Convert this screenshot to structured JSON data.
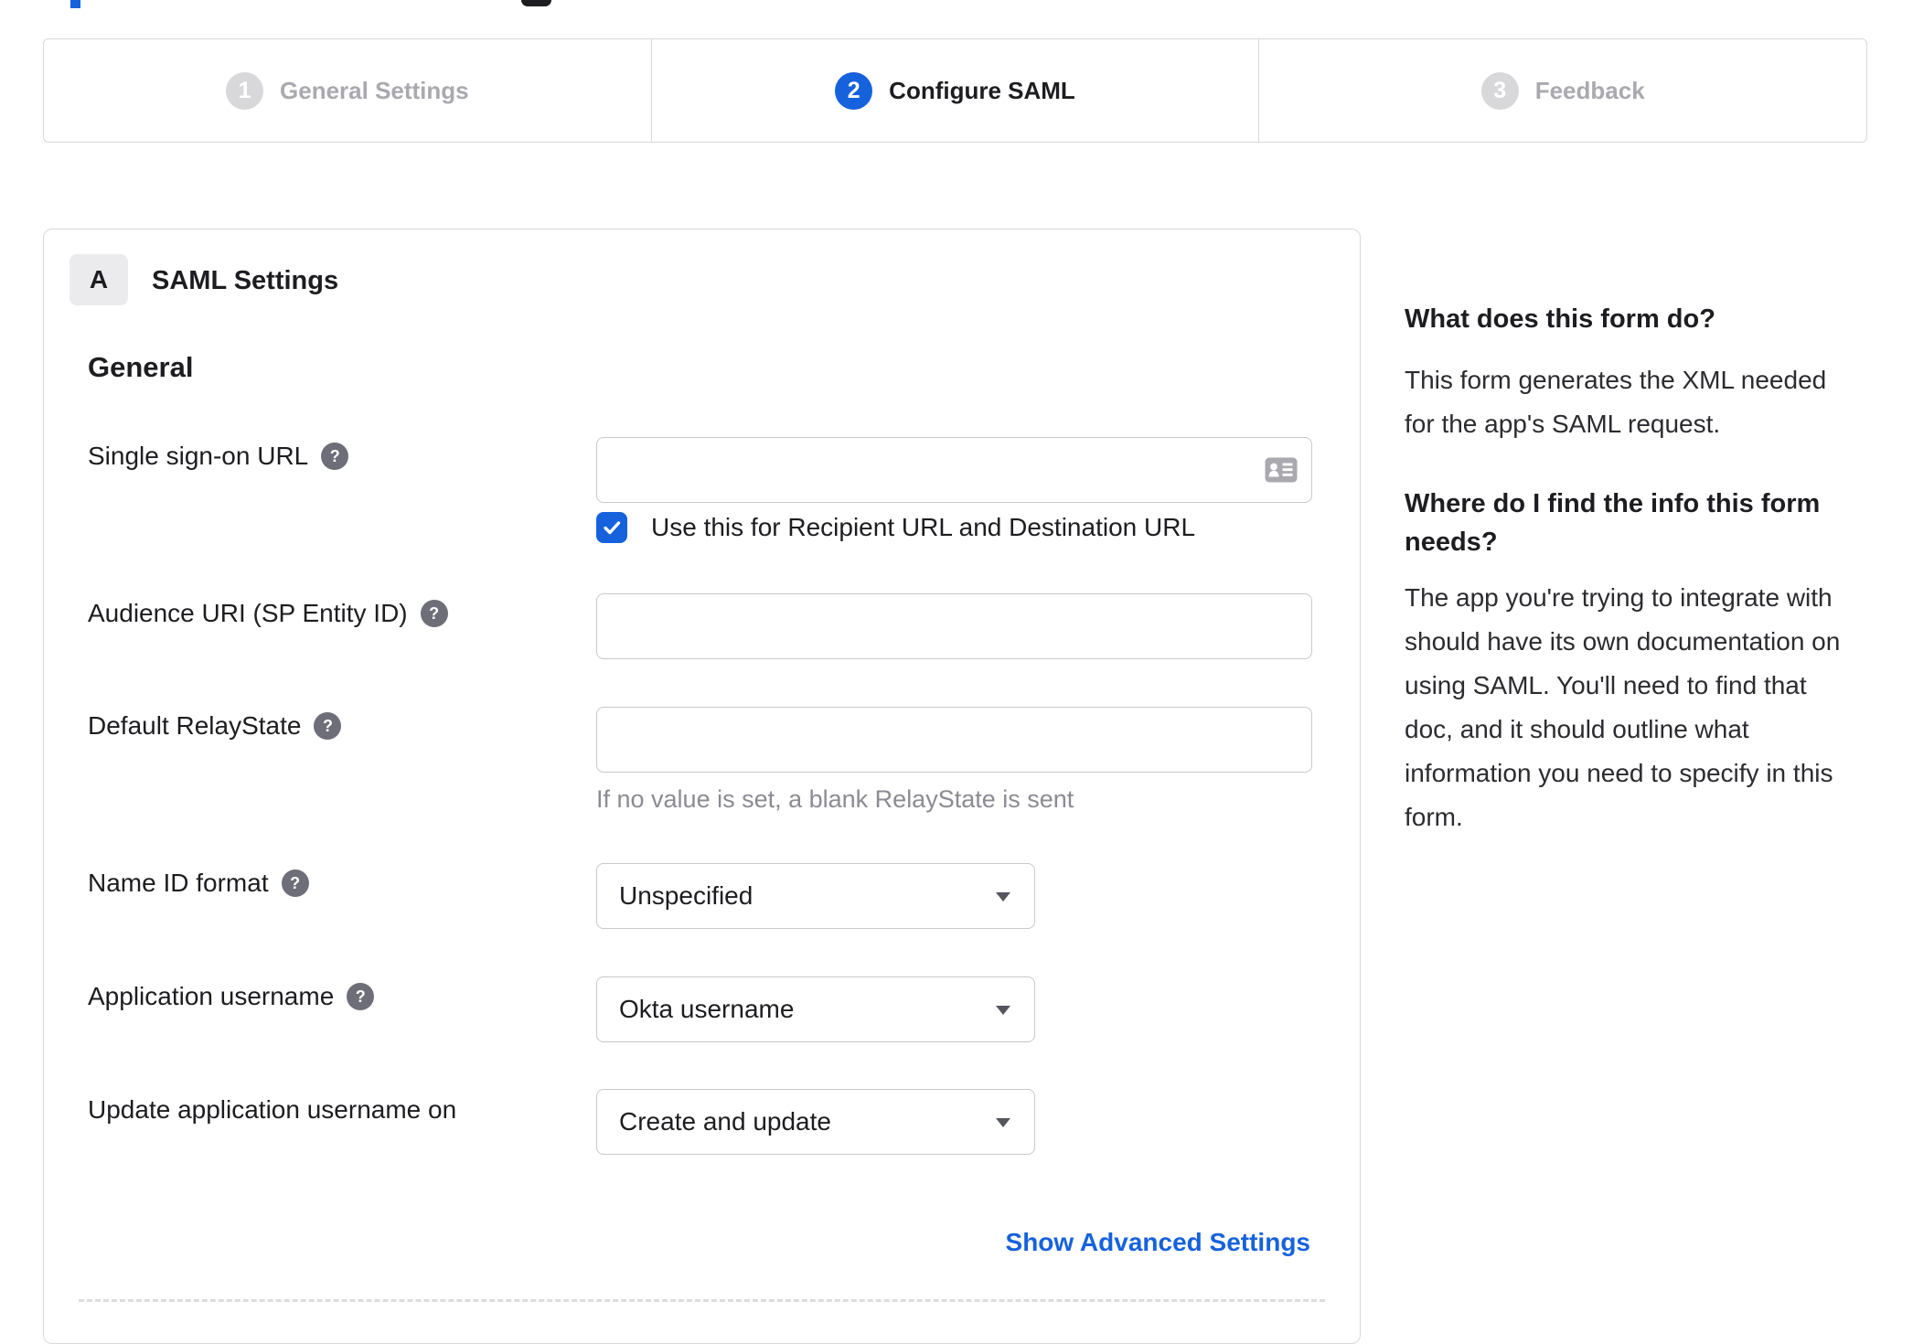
{
  "stepper": {
    "active_step": "2",
    "steps": [
      {
        "number": "1",
        "label": "General Settings"
      },
      {
        "number": "2",
        "label": "Configure SAML"
      },
      {
        "number": "3",
        "label": "Feedback"
      }
    ]
  },
  "panel": {
    "badge": "A",
    "title": "SAML Settings",
    "section": "General",
    "help_glyph": "?",
    "fields": {
      "sso": {
        "label": "Single sign-on URL",
        "value": "",
        "checkbox_label": "Use this for Recipient URL and Destination URL",
        "checkbox_checked": true
      },
      "audience": {
        "label": "Audience URI (SP Entity ID)",
        "value": ""
      },
      "relay": {
        "label": "Default RelayState",
        "value": "",
        "helper": "If no value is set, a blank RelayState is sent"
      },
      "nameid": {
        "label": "Name ID format",
        "value": "Unspecified"
      },
      "appuser": {
        "label": "Application username",
        "value": "Okta username"
      },
      "update": {
        "label": "Update application username on",
        "value": "Create and update"
      }
    },
    "advanced_link": "Show Advanced Settings"
  },
  "sidebar": {
    "heading1": "What does this form do?",
    "para1": "This form generates the XML needed\nfor the app's SAML request.",
    "heading2": "Where do I find the info this form\nneeds?",
    "para2": "The app you're trying to integrate with\nshould have its own documentation on\nusing SAML. You'll need to find that\ndoc, and it should outline what\ninformation you need to specify in this\nform."
  },
  "colors": {
    "accent": "#1662dd",
    "border": "#d8d8de",
    "text": "#1d1d21",
    "inactive": "#a9a9af",
    "helper_text": "#8b8b93"
  }
}
